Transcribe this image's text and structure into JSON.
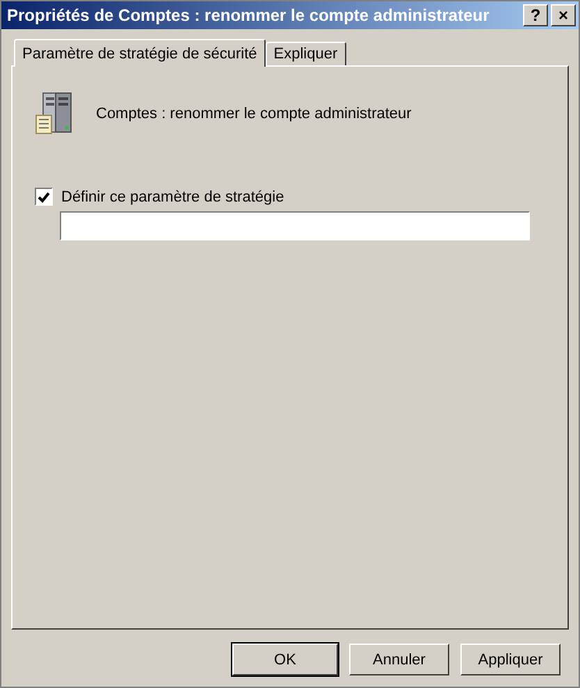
{
  "window": {
    "title": "Propriétés de Comptes : renommer le compte administrateur",
    "help": "?",
    "close": "×"
  },
  "tabs": [
    {
      "label": "Paramètre de stratégie de sécurité",
      "selected": true
    },
    {
      "label": "Expliquer",
      "selected": false
    }
  ],
  "policy": {
    "name": "Comptes : renommer le compte administrateur"
  },
  "define": {
    "label": "Définir ce paramètre de stratégie",
    "checked": true
  },
  "buttons": [
    {
      "label": "OK",
      "default": true
    },
    {
      "label": "Annuler",
      "default": false
    },
    {
      "label": "Appliquer",
      "default": false
    }
  ]
}
